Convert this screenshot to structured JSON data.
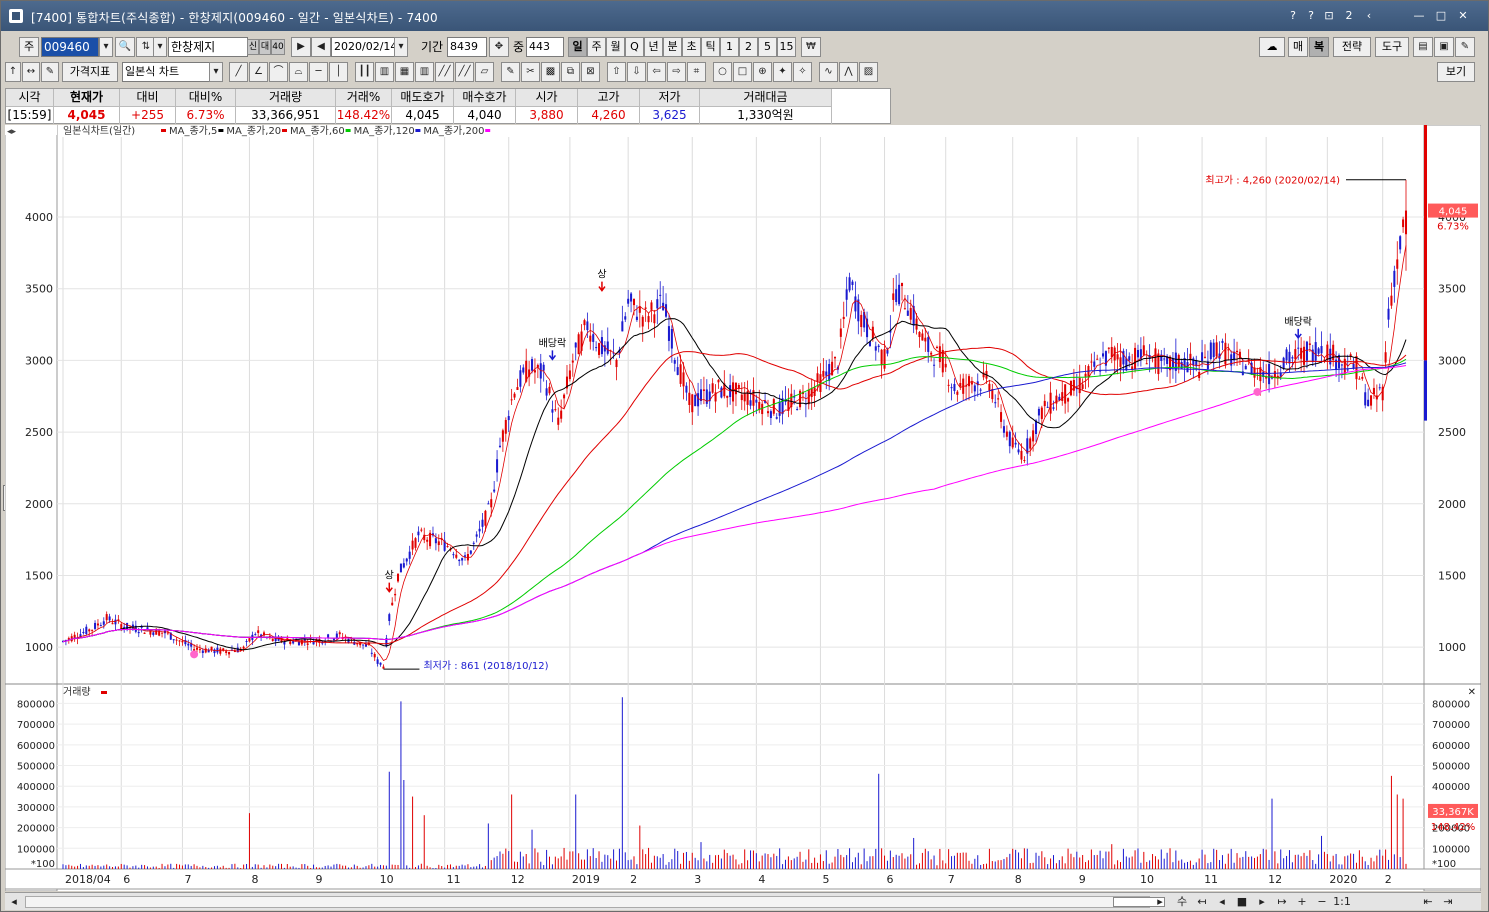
{
  "window": {
    "title": "[7400] 통합차트(주식종합) - 한창제지(009460 - 일간 - 일본식차트) - 7400",
    "title_buttons": [
      "?",
      "?",
      "⊡",
      "2",
      "‹",
      "—",
      "□",
      "✕"
    ]
  },
  "toolbar1": {
    "mode_label": "주",
    "code_value": "009460",
    "name_value": "한창제지",
    "badges": [
      "신",
      "대",
      "40"
    ],
    "date_value": "2020/02/14",
    "period_label": "기간",
    "period_value": "8439",
    "count_label": "중",
    "count_value": "443",
    "intervals": [
      "일",
      "주",
      "월",
      "Q",
      "년",
      "분",
      "초",
      "틱",
      "1",
      "2",
      "5",
      "15"
    ],
    "right_buttons": [
      "매",
      "복",
      "전략",
      "도구"
    ]
  },
  "toolbar2": {
    "indicator_label": "가격지표",
    "chart_type_value": "일본식 차트",
    "view_label": "보기"
  },
  "quote": {
    "headers": [
      "시각",
      "현재가",
      "대비",
      "대비%",
      "거래량",
      "거래%",
      "매도호가",
      "매수호가",
      "시가",
      "고가",
      "저가",
      "거래대금"
    ],
    "values": [
      "[15:59]",
      "4,045",
      "+255",
      "6.73%",
      "33,366,951",
      "148.42%",
      "4,045",
      "4,040",
      "3,880",
      "4,260",
      "3,625",
      "1,330억원"
    ]
  },
  "chart_data": {
    "type": "candlestick",
    "legend_title": "일본식차트(일간)",
    "ma_series": [
      {
        "name": "MA_종가,5",
        "color": "#e00000"
      },
      {
        "name": "MA_종가,20",
        "color": "#000000"
      },
      {
        "name": "MA_종가,60",
        "color": "#e00000"
      },
      {
        "name": "MA_종가,120",
        "color": "#00cc00"
      },
      {
        "name": "MA_종가,200",
        "color": "#1a1ad0"
      }
    ],
    "ma_last_color": "#ff00ff",
    "price_ticks": [
      1000,
      1500,
      2000,
      2500,
      3000,
      3500,
      4000
    ],
    "price_tick_labels": [
      "1000",
      "1500",
      "2000",
      "2500",
      "3000",
      "3500",
      "4000"
    ],
    "price_range": [
      750,
      4600
    ],
    "x_labels": [
      "2018/04",
      "6",
      "7",
      "8",
      "9",
      "10",
      "11",
      "12",
      "2019",
      "2",
      "3",
      "4",
      "5",
      "6",
      "7",
      "8",
      "9",
      "10",
      "11",
      "12",
      "2020",
      "2"
    ],
    "x_label_index": [
      0,
      20,
      41,
      64,
      86,
      108,
      131,
      153,
      174,
      194,
      216,
      238,
      260,
      282,
      303,
      326,
      348,
      369,
      391,
      413,
      434,
      453
    ],
    "n_bars": 462,
    "close_anchors": [
      [
        0,
        1040
      ],
      [
        10,
        1130
      ],
      [
        15,
        1200
      ],
      [
        22,
        1140
      ],
      [
        35,
        1100
      ],
      [
        45,
        990
      ],
      [
        55,
        970
      ],
      [
        62,
        990
      ],
      [
        66,
        1100
      ],
      [
        72,
        1050
      ],
      [
        80,
        1040
      ],
      [
        88,
        1050
      ],
      [
        95,
        1080
      ],
      [
        105,
        1000
      ],
      [
        108,
        900
      ],
      [
        110,
        870
      ],
      [
        112,
        1200
      ],
      [
        115,
        1500
      ],
      [
        122,
        1780
      ],
      [
        128,
        1740
      ],
      [
        133,
        1700
      ],
      [
        138,
        1600
      ],
      [
        142,
        1750
      ],
      [
        147,
        2000
      ],
      [
        150,
        2400
      ],
      [
        155,
        2800
      ],
      [
        160,
        2950
      ],
      [
        165,
        2900
      ],
      [
        170,
        2550
      ],
      [
        175,
        3000
      ],
      [
        180,
        3250
      ],
      [
        184,
        3100
      ],
      [
        190,
        3000
      ],
      [
        194,
        3400
      ],
      [
        200,
        3300
      ],
      [
        206,
        3400
      ],
      [
        210,
        3050
      ],
      [
        215,
        2700
      ],
      [
        225,
        2800
      ],
      [
        235,
        2750
      ],
      [
        245,
        2650
      ],
      [
        255,
        2750
      ],
      [
        262,
        2900
      ],
      [
        266,
        3000
      ],
      [
        270,
        3550
      ],
      [
        274,
        3300
      ],
      [
        278,
        3150
      ],
      [
        282,
        3000
      ],
      [
        286,
        3500
      ],
      [
        290,
        3400
      ],
      [
        296,
        3100
      ],
      [
        302,
        3000
      ],
      [
        306,
        2800
      ],
      [
        312,
        2850
      ],
      [
        318,
        2850
      ],
      [
        322,
        2600
      ],
      [
        326,
        2400
      ],
      [
        330,
        2350
      ],
      [
        336,
        2650
      ],
      [
        342,
        2750
      ],
      [
        348,
        2800
      ],
      [
        354,
        2950
      ],
      [
        360,
        3050
      ],
      [
        366,
        3000
      ],
      [
        372,
        3050
      ],
      [
        378,
        2950
      ],
      [
        384,
        3000
      ],
      [
        390,
        2950
      ],
      [
        396,
        3100
      ],
      [
        402,
        3000
      ],
      [
        408,
        2950
      ],
      [
        414,
        2900
      ],
      [
        420,
        3000
      ],
      [
        426,
        3050
      ],
      [
        432,
        3100
      ],
      [
        438,
        3000
      ],
      [
        444,
        2950
      ],
      [
        448,
        2700
      ],
      [
        451,
        2750
      ],
      [
        453,
        2800
      ],
      [
        455,
        3300
      ],
      [
        457,
        3600
      ],
      [
        459,
        3800
      ],
      [
        461,
        4045
      ]
    ],
    "annotations": [
      {
        "label": "최고가 : 4,260 (2020/02/14)",
        "bar": 461,
        "price": 4260
      },
      {
        "label": "최저가 : 861 (2018/10/12)",
        "bar": 110,
        "price": 861
      }
    ],
    "event_labels": [
      {
        "label": "상",
        "bar": 112,
        "price": 1380
      },
      {
        "label": "상",
        "bar": 185,
        "price": 3480
      },
      {
        "label": "배당락",
        "bar": 168,
        "price": 3000
      },
      {
        "label": "배당락",
        "bar": 424,
        "price": 3150
      }
    ],
    "right_badges": {
      "price": "4,045",
      "change": "6.73%"
    },
    "volume": {
      "title": "거래량",
      "ticks": [
        100000,
        200000,
        300000,
        400000,
        500000,
        600000,
        700000,
        800000
      ],
      "tick_labels": [
        "100000",
        "200000",
        "300000",
        "400000",
        "500000",
        "600000",
        "700000",
        "800000"
      ],
      "range": [
        0,
        860000
      ],
      "unit_label": "*100",
      "badge_value": "33,367K",
      "badge_pct": "148.42%",
      "spikes": [
        [
          64,
          270000
        ],
        [
          112,
          470000
        ],
        [
          116,
          810000
        ],
        [
          117,
          430000
        ],
        [
          120,
          350000
        ],
        [
          124,
          260000
        ],
        [
          146,
          220000
        ],
        [
          154,
          360000
        ],
        [
          161,
          190000
        ],
        [
          176,
          360000
        ],
        [
          192,
          830000
        ],
        [
          198,
          210000
        ],
        [
          219,
          130000
        ],
        [
          280,
          460000
        ],
        [
          292,
          150000
        ],
        [
          360,
          120000
        ],
        [
          415,
          340000
        ],
        [
          432,
          160000
        ],
        [
          456,
          450000
        ],
        [
          458,
          360000
        ],
        [
          460,
          340000
        ]
      ]
    }
  },
  "bottom": {
    "buttons": [
      "수",
      "↤",
      "◂",
      "■",
      "▸",
      "↦",
      "+",
      "−",
      "1:1",
      "⇤",
      "⇥"
    ]
  }
}
